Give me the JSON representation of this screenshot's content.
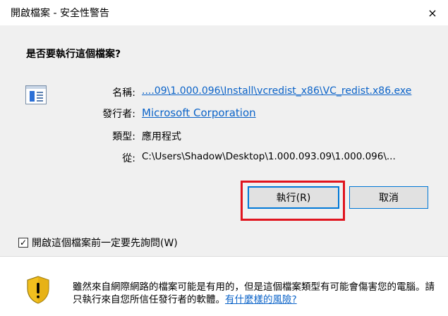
{
  "window": {
    "title": "開啟檔案 - 安全性警告",
    "close_symbol": "×"
  },
  "prompt": {
    "question": "是否要執行這個檔案?"
  },
  "file_info": {
    "name_label": "名稱:",
    "name_value": "....09\\1.000.096\\Install\\vcredist_x86\\VC_redist.x86.exe",
    "publisher_label": "發行者:",
    "publisher_value": "Microsoft Corporation",
    "type_label": "類型:",
    "type_value": "應用程式",
    "from_label": "從:",
    "from_value": "C:\\Users\\Shadow\\Desktop\\1.000.093.09\\1.000.096\\..."
  },
  "buttons": {
    "run_label": "執行(R)",
    "cancel_label": "取消"
  },
  "checkbox": {
    "checked": true,
    "check_mark": "✓",
    "label": "開啟這個檔案前一定要先詢問(W)"
  },
  "warning": {
    "text": "雖然來自網際網路的檔案可能是有用的，但是這個檔案類型有可能會傷害您的電腦。請只執行來自您所信任發行者的軟體。",
    "link_text": "有什麼樣的風險?"
  },
  "colors": {
    "link": "#0b63c8",
    "highlight": "#e0141e",
    "focus_border": "#0078d7",
    "shield_gold": "#f2c01e"
  },
  "icons": {
    "app": "application-window-icon",
    "shield": "security-shield-warning-icon",
    "close": "close-icon"
  }
}
